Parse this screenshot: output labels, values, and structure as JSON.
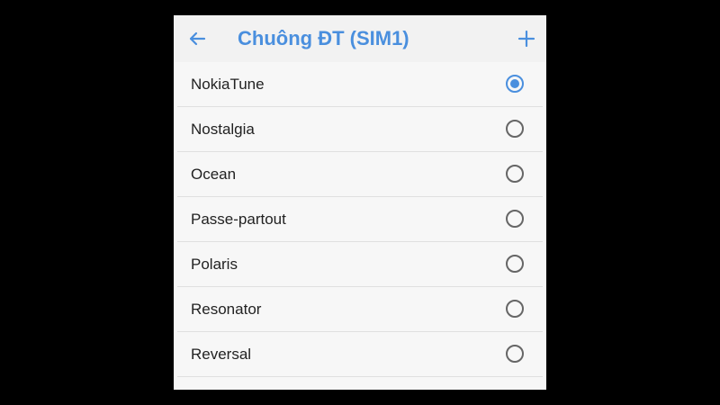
{
  "header": {
    "title": "Chuông ĐT (SIM1)",
    "back_icon": "arrow-left-icon",
    "add_icon": "plus-icon"
  },
  "colors": {
    "accent": "#4a8fde",
    "background": "#f7f7f7",
    "text": "#222222"
  },
  "ringtones": {
    "selected": "NokiaTune",
    "items": [
      {
        "label": "NokiaTune",
        "checked": true
      },
      {
        "label": "Nostalgia",
        "checked": false
      },
      {
        "label": "Ocean",
        "checked": false
      },
      {
        "label": "Passe-partout",
        "checked": false
      },
      {
        "label": "Polaris",
        "checked": false
      },
      {
        "label": "Resonator",
        "checked": false
      },
      {
        "label": "Reversal",
        "checked": false
      }
    ]
  }
}
